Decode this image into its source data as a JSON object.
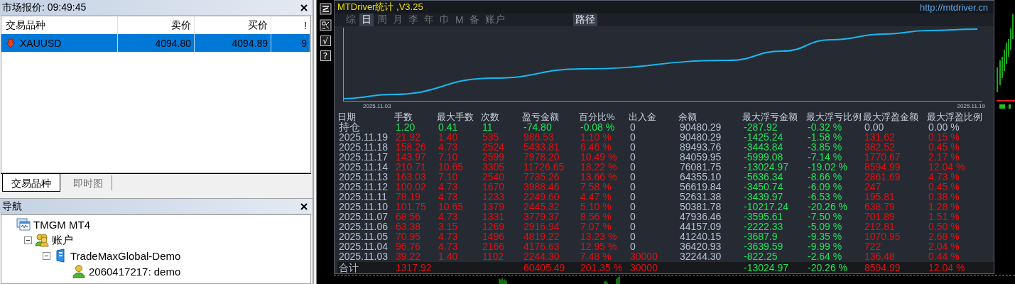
{
  "market_watch": {
    "title": "市场报价: 09:49:45",
    "columns": [
      "交易品种",
      "卖价",
      "买价",
      "!"
    ],
    "rows": [
      {
        "symbol": "XAUUSD",
        "bid": "4094.80",
        "ask": "4094.89",
        "spread": "9",
        "selected": true
      }
    ],
    "tabs": [
      {
        "label": "交易品种",
        "selected": true
      },
      {
        "label": "即时图",
        "selected": false
      }
    ]
  },
  "navigator": {
    "title": "导航",
    "tree": [
      {
        "label": "TMGM MT4",
        "kind": "terminal",
        "children": [
          {
            "label": "账户",
            "kind": "accounts",
            "expanded": true,
            "children": [
              {
                "label": "TradeMaxGlobal-Demo",
                "kind": "server",
                "expanded": true,
                "children": [
                  {
                    "label": "2060417217: demo",
                    "kind": "account"
                  }
                ]
              }
            ]
          }
        ]
      }
    ]
  },
  "toolbar_buttons": [
    "√",
    "?"
  ],
  "stats": {
    "title": "MTDriver统计 ,V3.25",
    "link": "http://mtdriver.cn",
    "tabs": [
      {
        "label": "综",
        "selected": false
      },
      {
        "label": "日",
        "selected": true
      },
      {
        "label": "周",
        "selected": false
      },
      {
        "label": "月",
        "selected": false
      },
      {
        "label": "李",
        "selected": false
      },
      {
        "label": "年",
        "selected": false
      },
      {
        "label": "巾",
        "selected": false
      },
      {
        "label": "M",
        "selected": false
      },
      {
        "label": "备",
        "selected": false
      },
      {
        "label": "账户",
        "selected": false
      }
    ],
    "path_button": "路径",
    "chart": {
      "start_label": "2025.11.03",
      "end_label": "2025.11.19"
    },
    "columns": [
      "日期",
      "手数",
      "最大手数",
      "次数",
      "盈亏金额",
      "百分比%",
      "出入金",
      "余额",
      "最大浮亏金额",
      "最大浮亏比例",
      "最大浮盈金额",
      "最大浮盈比例"
    ],
    "rows": [
      {
        "kind": "position",
        "cells": [
          {
            "text": "持仓",
            "color": "#b4c0d4"
          },
          {
            "text": "1.20",
            "color": "#1ee35a"
          },
          {
            "text": "0.41",
            "color": "#1ee35a"
          },
          {
            "text": "11",
            "color": "#1ee35a"
          },
          {
            "text": "-74.80",
            "color": "#1ee35a"
          },
          {
            "text": "-0.08 %",
            "color": "#1ee35a"
          },
          {
            "text": "0",
            "color": "#b4c0d4"
          },
          {
            "text": "90480.29",
            "color": "#b4c0d4"
          },
          {
            "text": "-287.92",
            "color": "#1ee35a"
          },
          {
            "text": "-0.32 %",
            "color": "#1ee35a"
          },
          {
            "text": "0.00",
            "color": "#b4c0d4"
          },
          {
            "text": "0.00 %",
            "color": "#b4c0d4"
          }
        ]
      },
      {
        "kind": "day",
        "cells": [
          {
            "text": "2025.11.19",
            "color": "#b4c0d4"
          },
          {
            "text": "21.92",
            "color": "#e01010"
          },
          {
            "text": "1.40",
            "color": "#e01010"
          },
          {
            "text": "535",
            "color": "#e01010"
          },
          {
            "text": "986.53",
            "color": "#e01010"
          },
          {
            "text": "1.10 %",
            "color": "#e01010"
          },
          {
            "text": "0",
            "color": "#b4c0d4"
          },
          {
            "text": "90480.29",
            "color": "#b4c0d4"
          },
          {
            "text": "-1425.24",
            "color": "#1ee35a"
          },
          {
            "text": "-1.58 %",
            "color": "#1ee35a"
          },
          {
            "text": "131.62",
            "color": "#e01010"
          },
          {
            "text": "0.15 %",
            "color": "#e01010"
          }
        ]
      },
      {
        "kind": "day",
        "cells": [
          {
            "text": "2025.11.18",
            "color": "#b4c0d4"
          },
          {
            "text": "158.26",
            "color": "#e01010"
          },
          {
            "text": "4.73",
            "color": "#e01010"
          },
          {
            "text": "2524",
            "color": "#e01010"
          },
          {
            "text": "5433.81",
            "color": "#e01010"
          },
          {
            "text": "6.46 %",
            "color": "#e01010"
          },
          {
            "text": "0",
            "color": "#b4c0d4"
          },
          {
            "text": "89493.76",
            "color": "#b4c0d4"
          },
          {
            "text": "-3443.84",
            "color": "#1ee35a"
          },
          {
            "text": "-3.85 %",
            "color": "#1ee35a"
          },
          {
            "text": "382.52",
            "color": "#e01010"
          },
          {
            "text": "0.45 %",
            "color": "#e01010"
          }
        ]
      },
      {
        "kind": "day",
        "cells": [
          {
            "text": "2025.11.17",
            "color": "#b4c0d4"
          },
          {
            "text": "143.97",
            "color": "#e01010"
          },
          {
            "text": "7.10",
            "color": "#e01010"
          },
          {
            "text": "2599",
            "color": "#e01010"
          },
          {
            "text": "7978.20",
            "color": "#e01010"
          },
          {
            "text": "10.49 %",
            "color": "#e01010"
          },
          {
            "text": "0",
            "color": "#b4c0d4"
          },
          {
            "text": "84059.95",
            "color": "#b4c0d4"
          },
          {
            "text": "-5999.08",
            "color": "#1ee35a"
          },
          {
            "text": "-7.14 %",
            "color": "#1ee35a"
          },
          {
            "text": "1770.67",
            "color": "#e01010"
          },
          {
            "text": "2.17 %",
            "color": "#e01010"
          }
        ]
      },
      {
        "kind": "day",
        "cells": [
          {
            "text": "2025.11.14",
            "color": "#b4c0d4"
          },
          {
            "text": "210.71",
            "color": "#e01010"
          },
          {
            "text": "10.65",
            "color": "#e01010"
          },
          {
            "text": "3305",
            "color": "#e01010"
          },
          {
            "text": "11726.65",
            "color": "#e01010"
          },
          {
            "text": "18.22 %",
            "color": "#e01010"
          },
          {
            "text": "0",
            "color": "#b4c0d4"
          },
          {
            "text": "76081.75",
            "color": "#b4c0d4"
          },
          {
            "text": "-13024.97",
            "color": "#1ee35a"
          },
          {
            "text": "-19.02 %",
            "color": "#1ee35a"
          },
          {
            "text": "8594.99",
            "color": "#e01010"
          },
          {
            "text": "12.04 %",
            "color": "#e01010"
          }
        ]
      },
      {
        "kind": "day",
        "cells": [
          {
            "text": "2025.11.13",
            "color": "#b4c0d4"
          },
          {
            "text": "163.03",
            "color": "#e01010"
          },
          {
            "text": "7.10",
            "color": "#e01010"
          },
          {
            "text": "2540",
            "color": "#e01010"
          },
          {
            "text": "7735.26",
            "color": "#e01010"
          },
          {
            "text": "13.66 %",
            "color": "#e01010"
          },
          {
            "text": "0",
            "color": "#b4c0d4"
          },
          {
            "text": "64355.10",
            "color": "#b4c0d4"
          },
          {
            "text": "-5636.34",
            "color": "#1ee35a"
          },
          {
            "text": "-8.66 %",
            "color": "#1ee35a"
          },
          {
            "text": "2861.69",
            "color": "#e01010"
          },
          {
            "text": "4.73 %",
            "color": "#e01010"
          }
        ]
      },
      {
        "kind": "day",
        "cells": [
          {
            "text": "2025.11.12",
            "color": "#b4c0d4"
          },
          {
            "text": "100.02",
            "color": "#e01010"
          },
          {
            "text": "4.73",
            "color": "#e01010"
          },
          {
            "text": "1670",
            "color": "#e01010"
          },
          {
            "text": "3988.46",
            "color": "#e01010"
          },
          {
            "text": "7.58 %",
            "color": "#e01010"
          },
          {
            "text": "0",
            "color": "#b4c0d4"
          },
          {
            "text": "56619.84",
            "color": "#b4c0d4"
          },
          {
            "text": "-3450.74",
            "color": "#1ee35a"
          },
          {
            "text": "-6.09 %",
            "color": "#1ee35a"
          },
          {
            "text": "247",
            "color": "#e01010"
          },
          {
            "text": "0.45 %",
            "color": "#e01010"
          }
        ]
      },
      {
        "kind": "day",
        "cells": [
          {
            "text": "2025.11.11",
            "color": "#b4c0d4"
          },
          {
            "text": "78.19",
            "color": "#e01010"
          },
          {
            "text": "4.73",
            "color": "#e01010"
          },
          {
            "text": "1233",
            "color": "#e01010"
          },
          {
            "text": "2249.60",
            "color": "#e01010"
          },
          {
            "text": "4.47 %",
            "color": "#e01010"
          },
          {
            "text": "0",
            "color": "#b4c0d4"
          },
          {
            "text": "52631.38",
            "color": "#b4c0d4"
          },
          {
            "text": "-3439.97",
            "color": "#1ee35a"
          },
          {
            "text": "-6.53 %",
            "color": "#1ee35a"
          },
          {
            "text": "195.81",
            "color": "#e01010"
          },
          {
            "text": "0.38 %",
            "color": "#e01010"
          }
        ]
      },
      {
        "kind": "day",
        "cells": [
          {
            "text": "2025.11.10",
            "color": "#b4c0d4"
          },
          {
            "text": "101.75",
            "color": "#e01010"
          },
          {
            "text": "10.65",
            "color": "#e01010"
          },
          {
            "text": "1379",
            "color": "#e01010"
          },
          {
            "text": "2445.32",
            "color": "#e01010"
          },
          {
            "text": "5.10 %",
            "color": "#e01010"
          },
          {
            "text": "0",
            "color": "#b4c0d4"
          },
          {
            "text": "50381.78",
            "color": "#b4c0d4"
          },
          {
            "text": "-10217.24",
            "color": "#1ee35a"
          },
          {
            "text": "-20.26 %",
            "color": "#1ee35a"
          },
          {
            "text": "638.79",
            "color": "#e01010"
          },
          {
            "text": "1.28 %",
            "color": "#e01010"
          }
        ]
      },
      {
        "kind": "day",
        "cells": [
          {
            "text": "2025.11.07",
            "color": "#b4c0d4"
          },
          {
            "text": "68.56",
            "color": "#e01010"
          },
          {
            "text": "4.73",
            "color": "#e01010"
          },
          {
            "text": "1331",
            "color": "#e01010"
          },
          {
            "text": "3779.37",
            "color": "#e01010"
          },
          {
            "text": "8.56 %",
            "color": "#e01010"
          },
          {
            "text": "0",
            "color": "#b4c0d4"
          },
          {
            "text": "47936.46",
            "color": "#b4c0d4"
          },
          {
            "text": "-3595.61",
            "color": "#1ee35a"
          },
          {
            "text": "-7.50 %",
            "color": "#1ee35a"
          },
          {
            "text": "701.89",
            "color": "#e01010"
          },
          {
            "text": "1.51 %",
            "color": "#e01010"
          }
        ]
      },
      {
        "kind": "day",
        "cells": [
          {
            "text": "2025.11.06",
            "color": "#b4c0d4"
          },
          {
            "text": "63.38",
            "color": "#e01010"
          },
          {
            "text": "3.15",
            "color": "#e01010"
          },
          {
            "text": "1269",
            "color": "#e01010"
          },
          {
            "text": "2916.94",
            "color": "#e01010"
          },
          {
            "text": "7.07 %",
            "color": "#e01010"
          },
          {
            "text": "0",
            "color": "#b4c0d4"
          },
          {
            "text": "44157.09",
            "color": "#b4c0d4"
          },
          {
            "text": "-2222.33",
            "color": "#1ee35a"
          },
          {
            "text": "-5.09 %",
            "color": "#1ee35a"
          },
          {
            "text": "212.81",
            "color": "#e01010"
          },
          {
            "text": "0.50 %",
            "color": "#e01010"
          }
        ]
      },
      {
        "kind": "day",
        "cells": [
          {
            "text": "2025.11.05",
            "color": "#b4c0d4"
          },
          {
            "text": "70.95",
            "color": "#e01010"
          },
          {
            "text": "4.73",
            "color": "#e01010"
          },
          {
            "text": "1496",
            "color": "#e01010"
          },
          {
            "text": "4819.22",
            "color": "#e01010"
          },
          {
            "text": "13.23 %",
            "color": "#e01010"
          },
          {
            "text": "0",
            "color": "#b4c0d4"
          },
          {
            "text": "41240.15",
            "color": "#b4c0d4"
          },
          {
            "text": "-3687.9",
            "color": "#1ee35a"
          },
          {
            "text": "-9.35 %",
            "color": "#1ee35a"
          },
          {
            "text": "1070.95",
            "color": "#e01010"
          },
          {
            "text": "2.68 %",
            "color": "#e01010"
          }
        ]
      },
      {
        "kind": "day",
        "cells": [
          {
            "text": "2025.11.04",
            "color": "#b4c0d4"
          },
          {
            "text": "96.76",
            "color": "#e01010"
          },
          {
            "text": "4.73",
            "color": "#e01010"
          },
          {
            "text": "2166",
            "color": "#e01010"
          },
          {
            "text": "4176.63",
            "color": "#e01010"
          },
          {
            "text": "12.95 %",
            "color": "#e01010"
          },
          {
            "text": "0",
            "color": "#b4c0d4"
          },
          {
            "text": "36420.93",
            "color": "#b4c0d4"
          },
          {
            "text": "-3639.59",
            "color": "#1ee35a"
          },
          {
            "text": "-9.99 %",
            "color": "#1ee35a"
          },
          {
            "text": "722",
            "color": "#e01010"
          },
          {
            "text": "2.04 %",
            "color": "#e01010"
          }
        ]
      },
      {
        "kind": "day",
        "cells": [
          {
            "text": "2025.11.03",
            "color": "#b4c0d4"
          },
          {
            "text": "39.22",
            "color": "#e01010"
          },
          {
            "text": "1.40",
            "color": "#e01010"
          },
          {
            "text": "1102",
            "color": "#e01010"
          },
          {
            "text": "2244.30",
            "color": "#e01010"
          },
          {
            "text": "7.48 %",
            "color": "#e01010"
          },
          {
            "text": "30000",
            "color": "#e01010"
          },
          {
            "text": "32244.30",
            "color": "#b4c0d4"
          },
          {
            "text": "-822.25",
            "color": "#1ee35a"
          },
          {
            "text": "-2.64 %",
            "color": "#1ee35a"
          },
          {
            "text": "136.48",
            "color": "#e01010"
          },
          {
            "text": "0.44 %",
            "color": "#e01010"
          }
        ]
      },
      {
        "kind": "total",
        "cells": [
          {
            "text": "合计",
            "color": "#b4c0d4"
          },
          {
            "text": "1317.92",
            "color": "#e01010"
          },
          null,
          null,
          {
            "text": "60405.49",
            "color": "#e01010"
          },
          {
            "text": "201.35 %",
            "color": "#e01010"
          },
          {
            "text": "30000",
            "color": "#e01010"
          },
          null,
          {
            "text": "-13024.97",
            "color": "#1ee35a"
          },
          {
            "text": "-20.26 %",
            "color": "#1ee35a"
          },
          {
            "text": "8594.99",
            "color": "#e01010"
          },
          {
            "text": "12.04 %",
            "color": "#e01010"
          }
        ]
      }
    ]
  }
}
